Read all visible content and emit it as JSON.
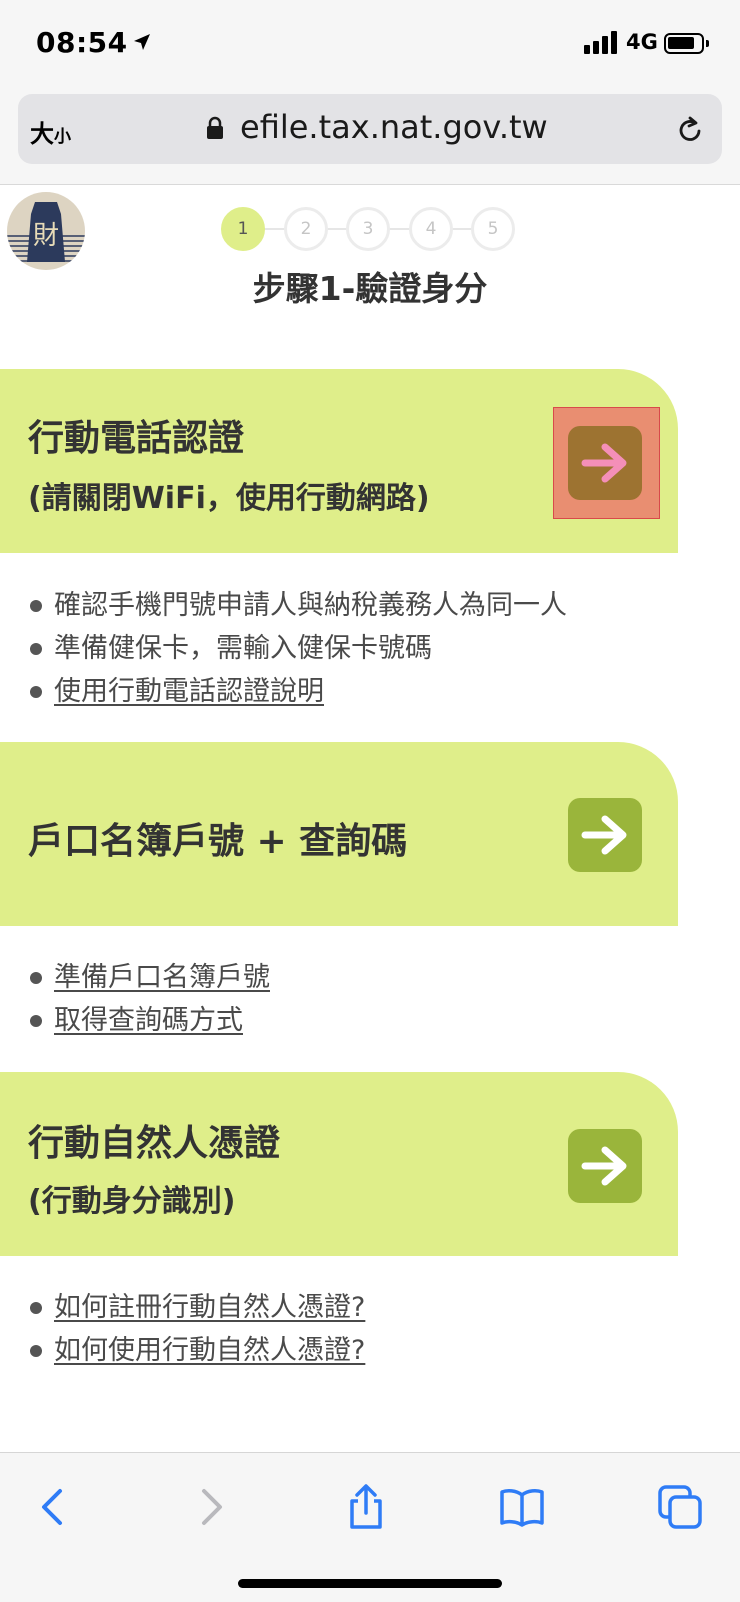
{
  "status_bar": {
    "time": "08:54",
    "network": "4G"
  },
  "address_bar": {
    "text_size_label_big": "大",
    "text_size_label_small": "小",
    "url": "efile.tax.nat.gov.tw"
  },
  "stepper": {
    "steps": [
      "1",
      "2",
      "3",
      "4",
      "5"
    ],
    "current": 1
  },
  "page_title": "步驟1-驗證身分",
  "cards": [
    {
      "title": "行動電話認證",
      "subtitle": "(請關閉WiFi，使用行動網路)",
      "bullets": [
        {
          "text": "確認手機門號申請人與納稅義務人為同一人",
          "link": false
        },
        {
          "text": "準備健保卡，需輸入健保卡號碼",
          "link": false
        },
        {
          "text": "使用行動電話認證說明",
          "link": true
        }
      ]
    },
    {
      "title": "戶口名簿戶號 + 查詢碼",
      "subtitle": "",
      "bullets": [
        {
          "text": "準備戶口名簿戶號",
          "link": true
        },
        {
          "text": "取得查詢碼方式",
          "link": true
        }
      ]
    },
    {
      "title": "行動自然人憑證",
      "subtitle": "(行動身分識別)",
      "bullets": [
        {
          "text": "如何註冊行動自然人憑證?",
          "link": true
        },
        {
          "text": "如何使用行動自然人憑證?",
          "link": true
        }
      ]
    }
  ],
  "icons": {
    "arrow": "arrow-right-icon",
    "back": "chevron-left-icon",
    "forward": "chevron-right-icon",
    "share": "share-icon",
    "bookmarks": "book-icon",
    "tabs": "tabs-icon"
  },
  "colors": {
    "card_bg": "#dfee8a",
    "button": "#9ab53b",
    "highlight": "#ea836e",
    "highlight_arrow": "#f48fb8",
    "ios_blue": "#2f7cf6"
  }
}
